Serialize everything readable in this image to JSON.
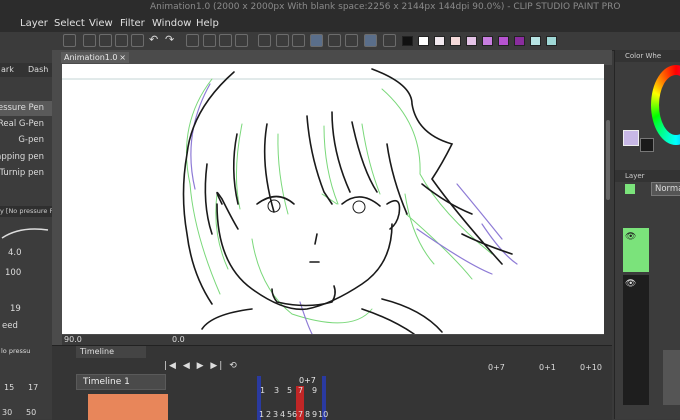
{
  "window": {
    "title": "Animation1.0 (2000 x 2000px With blank space:2256 x 2144px 144dpi 90.0%)  - CLIP STUDIO PAINT PRO"
  },
  "menubar": {
    "items": [
      "Layer",
      "Select",
      "View",
      "Filter",
      "Window",
      "Help"
    ]
  },
  "toolbar": {
    "colors": [
      "#111111",
      "#ffffff",
      "#f2e9ef",
      "#f4d9d9",
      "#e4c3e7",
      "#c87ee0",
      "#b653d0",
      "#8a2d9e",
      "#b7e3e3",
      "#9fd8d6"
    ]
  },
  "left_panel": {
    "tabs": [
      "ark",
      "Dash"
    ],
    "brushes": [
      "essure Pen",
      "Real G-Pen",
      "G-pen",
      "apping pen",
      "Turnip pen"
    ],
    "selected_brush": "y [No pressure P",
    "size_value": "4.0",
    "opacity_value": "100",
    "stabilizer_value": "19",
    "speed_label": "eed",
    "sub_label": "lo pressu",
    "preset_sizes": [
      "15",
      "17",
      "30",
      "50"
    ]
  },
  "document": {
    "tab_label": "Animation1.0",
    "zoom": "90.0",
    "angle": "0.0"
  },
  "right_panel": {
    "color_header": "Color Whe",
    "layer_header": "Layer",
    "blend_mode": "Norma"
  },
  "timeline": {
    "header": "Timeline",
    "name": "Timeline 1",
    "current_frame": "0+7",
    "frame_a": "0+7",
    "frame_b": "0+1",
    "frame_c": "0+10",
    "frame_numbers": [
      "1",
      "2",
      "3",
      "4",
      "5",
      "6",
      "7",
      "8",
      "9",
      "10"
    ],
    "marker_numbers": [
      "1",
      "3",
      "5",
      "7",
      "9"
    ]
  }
}
